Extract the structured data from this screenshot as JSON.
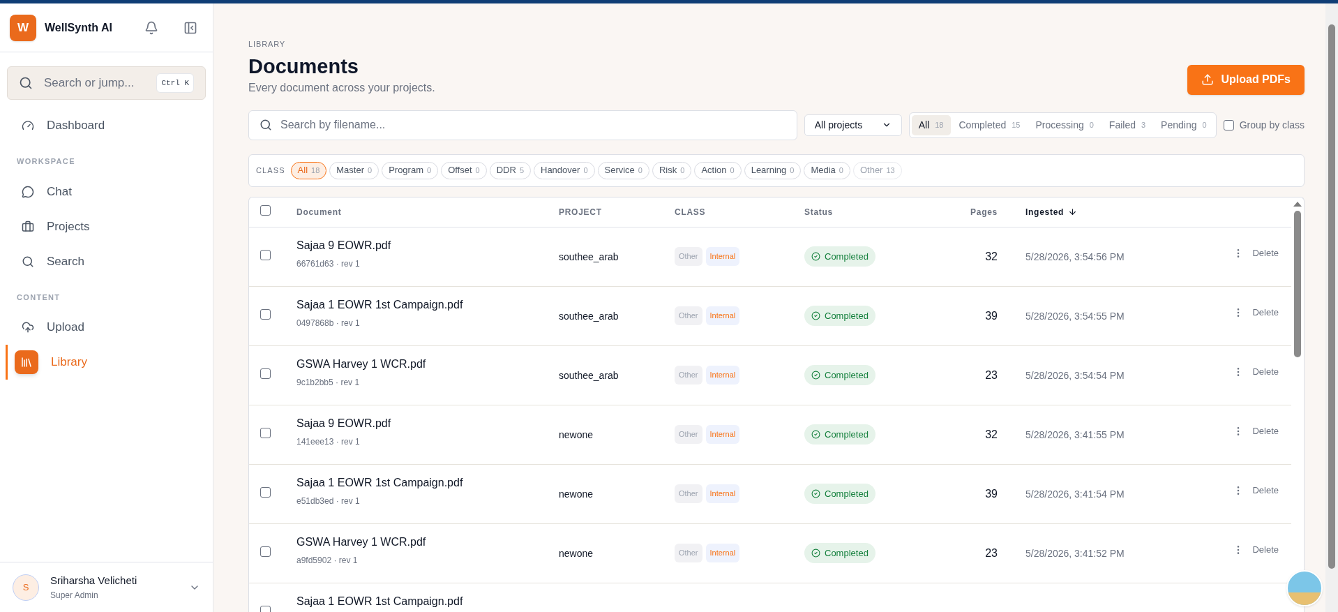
{
  "app": {
    "logo_letter": "W",
    "name": "WellSynth AI"
  },
  "sidebar": {
    "search": {
      "placeholder": "Search or jump...",
      "shortcut": "Ctrl K"
    },
    "sections": [
      {
        "items": [
          {
            "label": "Dashboard",
            "selected": false
          }
        ]
      },
      {
        "heading": "WORKSPACE",
        "items": [
          {
            "label": "Chat",
            "selected": false
          },
          {
            "label": "Projects",
            "selected": false
          },
          {
            "label": "Search",
            "selected": false
          }
        ]
      },
      {
        "heading": "CONTENT",
        "items": [
          {
            "label": "Upload",
            "selected": false
          },
          {
            "label": "Library",
            "selected": true
          }
        ]
      }
    ],
    "user": {
      "initial": "S",
      "name": "Sriharsha Velicheti",
      "role": "Super Admin"
    }
  },
  "page": {
    "eyebrow": "LIBRARY",
    "title": "Documents",
    "subtitle": "Every document across your projects.",
    "upload_button": "Upload PDFs"
  },
  "filters": {
    "search": {
      "placeholder": "Search by filename..."
    },
    "project_select": "All projects",
    "status_tabs": [
      {
        "label": "All",
        "count": "18",
        "selected": true
      },
      {
        "label": "Completed",
        "count": "15",
        "selected": false
      },
      {
        "label": "Processing",
        "count": "0",
        "selected": false
      },
      {
        "label": "Failed",
        "count": "3",
        "selected": false
      },
      {
        "label": "Pending",
        "count": "0",
        "selected": false
      }
    ],
    "group_by_class": {
      "label": "Group by class",
      "checked": false
    },
    "class_label": "CLASS",
    "classes": [
      {
        "label": "All",
        "count": "18",
        "selected": true,
        "disabled": false
      },
      {
        "label": "Master",
        "count": "0",
        "selected": false,
        "disabled": false
      },
      {
        "label": "Program",
        "count": "0",
        "selected": false,
        "disabled": false
      },
      {
        "label": "Offset",
        "count": "0",
        "selected": false,
        "disabled": false
      },
      {
        "label": "DDR",
        "count": "5",
        "selected": false,
        "disabled": false
      },
      {
        "label": "Handover",
        "count": "0",
        "selected": false,
        "disabled": false
      },
      {
        "label": "Service",
        "count": "0",
        "selected": false,
        "disabled": false
      },
      {
        "label": "Risk",
        "count": "0",
        "selected": false,
        "disabled": false
      },
      {
        "label": "Action",
        "count": "0",
        "selected": false,
        "disabled": false
      },
      {
        "label": "Learning",
        "count": "0",
        "selected": false,
        "disabled": false
      },
      {
        "label": "Media",
        "count": "0",
        "selected": false,
        "disabled": false
      },
      {
        "label": "Other",
        "count": "13",
        "selected": false,
        "disabled": true
      }
    ]
  },
  "table": {
    "select_all_checked": false,
    "columns": [
      {
        "label": "Document",
        "sorted": false
      },
      {
        "label": "PROJECT",
        "sorted": false
      },
      {
        "label": "CLASS",
        "sorted": false
      },
      {
        "label": "Status",
        "sorted": false
      },
      {
        "label": "Pages",
        "sorted": false
      },
      {
        "label": "Ingested",
        "sorted": true
      }
    ],
    "rows": [
      {
        "name": "Sajaa 9 EOWR.pdf",
        "meta": "66761d63 · rev 1",
        "project": "southee_arab",
        "class": "Other",
        "scope": "Internal",
        "status": "Completed",
        "pages": "32",
        "ingested": "5/28/2026, 3:54:56 PM",
        "action": "Delete",
        "checked": false
      },
      {
        "name": "Sajaa 1 EOWR 1st Campaign.pdf",
        "meta": "0497868b · rev 1",
        "project": "southee_arab",
        "class": "Other",
        "scope": "Internal",
        "status": "Completed",
        "pages": "39",
        "ingested": "5/28/2026, 3:54:55 PM",
        "action": "Delete",
        "checked": false
      },
      {
        "name": "GSWA Harvey 1 WCR.pdf",
        "meta": "9c1b2bb5 · rev 1",
        "project": "southee_arab",
        "class": "Other",
        "scope": "Internal",
        "status": "Completed",
        "pages": "23",
        "ingested": "5/28/2026, 3:54:54 PM",
        "action": "Delete",
        "checked": false
      },
      {
        "name": "Sajaa 9 EOWR.pdf",
        "meta": "141eee13 · rev 1",
        "project": "newone",
        "class": "Other",
        "scope": "Internal",
        "status": "Completed",
        "pages": "32",
        "ingested": "5/28/2026, 3:41:55 PM",
        "action": "Delete",
        "checked": false
      },
      {
        "name": "Sajaa 1 EOWR 1st Campaign.pdf",
        "meta": "e51db3ed · rev 1",
        "project": "newone",
        "class": "Other",
        "scope": "Internal",
        "status": "Completed",
        "pages": "39",
        "ingested": "5/28/2026, 3:41:54 PM",
        "action": "Delete",
        "checked": false
      },
      {
        "name": "GSWA Harvey 1 WCR.pdf",
        "meta": "a9fd5902 · rev 1",
        "project": "newone",
        "class": "Other",
        "scope": "Internal",
        "status": "Completed",
        "pages": "23",
        "ingested": "5/28/2026, 3:41:52 PM",
        "action": "Delete",
        "checked": false
      },
      {
        "name": "Sajaa 1 EOWR 1st Campaign.pdf",
        "checked": false
      }
    ]
  }
}
